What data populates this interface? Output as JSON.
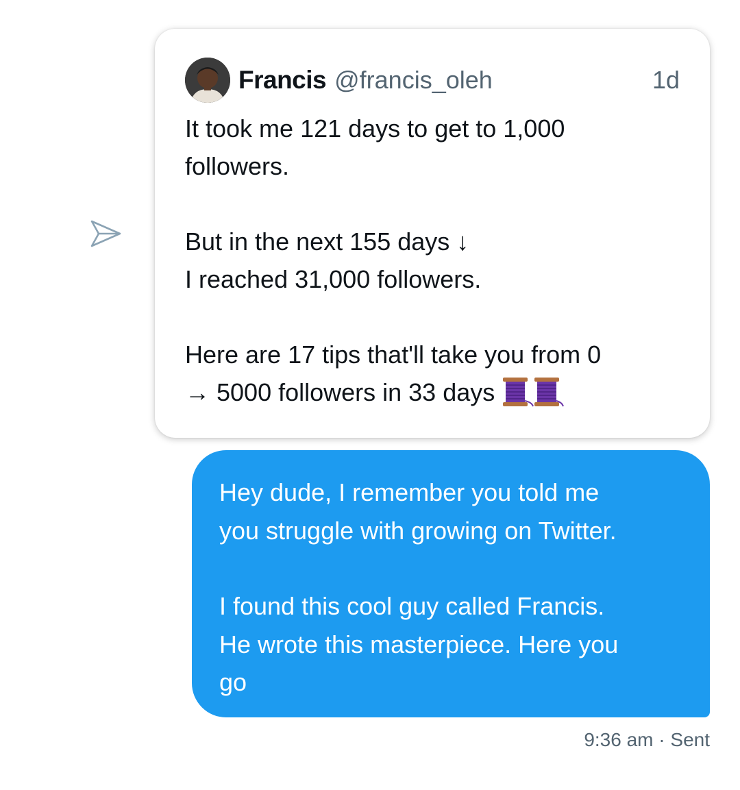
{
  "shared_tweet": {
    "author_name": "Francis",
    "author_handle": "@francis_oleh",
    "timestamp": "1d",
    "lines": [
      "It took me 121 days to get to 1,000",
      "followers.",
      "",
      "But in the next 155 days ↓",
      "I reached 31,000 followers.",
      "",
      "Here are 17 tips that'll take you from 0",
      "→ 5000 followers in 33 days"
    ],
    "emoji": "thread-spool-icon"
  },
  "message": {
    "lines": [
      "Hey dude, I remember you told me",
      "you struggle with growing on Twitter.",
      "",
      "I found this cool guy called Francis.",
      "He wrote this masterpiece. Here you",
      "go"
    ],
    "time": "9:36 am",
    "separator": "·",
    "status": "Sent",
    "bubble_color": "#1d9bf0"
  },
  "icons": {
    "share": "send-icon"
  }
}
